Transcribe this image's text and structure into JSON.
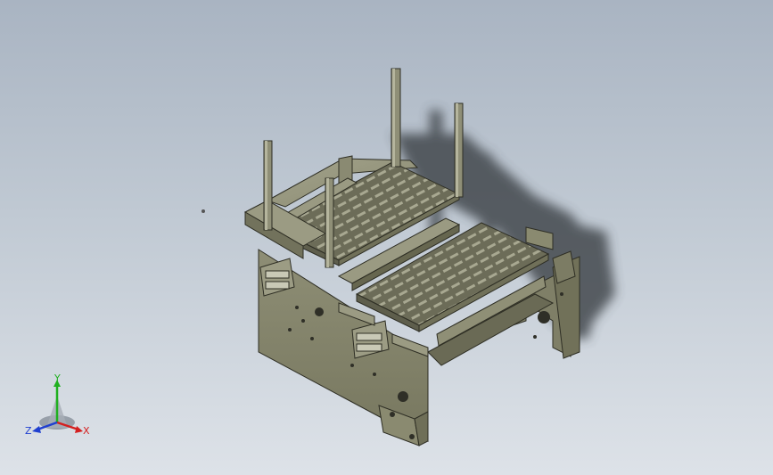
{
  "viewport": {
    "background_top": "#a9b4c2",
    "background_bottom": "#dde2e8",
    "model_color": "#8c8c72",
    "shadow_color": "#3a3f44"
  },
  "triad": {
    "x_label": "X",
    "y_label": "Y",
    "z_label": "Z",
    "x_color": "#d42020",
    "y_color": "#20b020",
    "z_color": "#2040d0"
  }
}
